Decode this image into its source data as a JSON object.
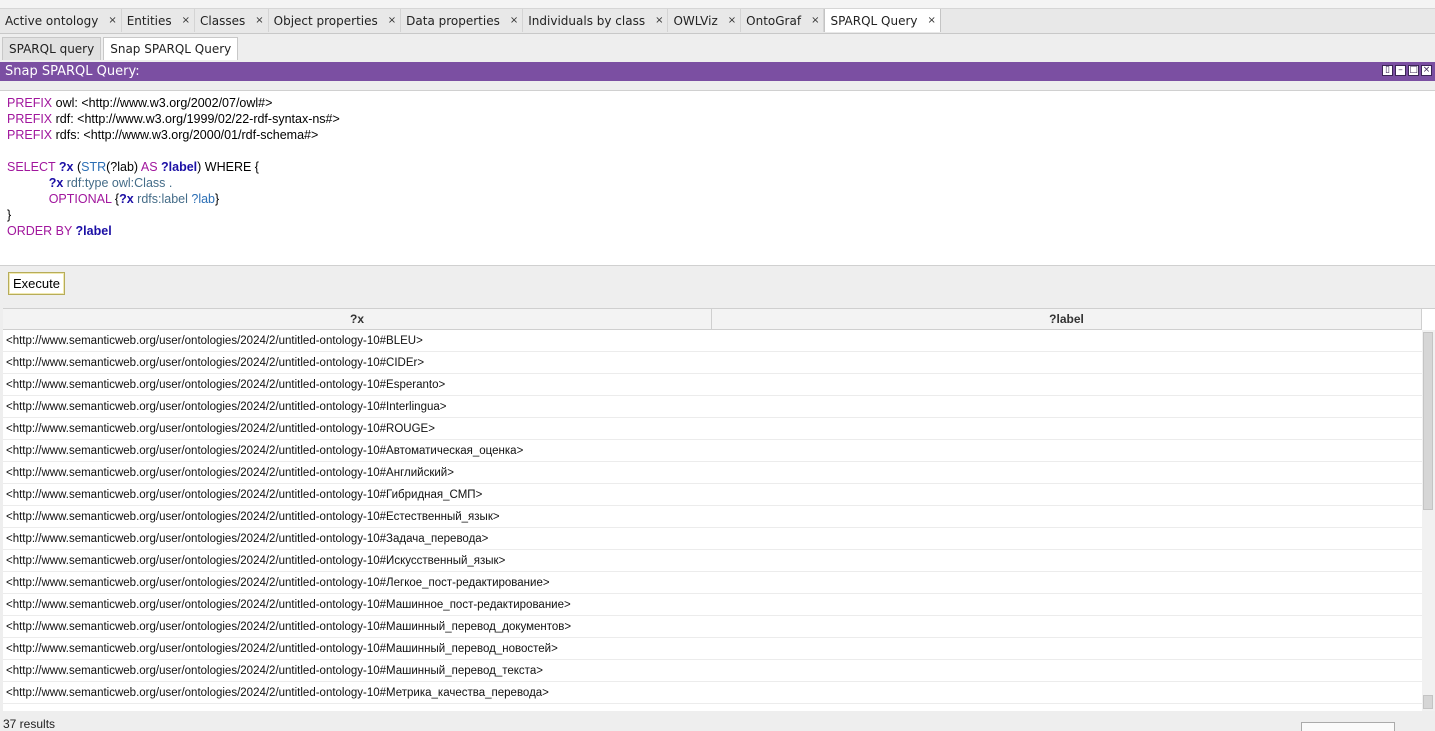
{
  "tabs": [
    {
      "label": "Active ontology",
      "active": false
    },
    {
      "label": "Entities",
      "active": false
    },
    {
      "label": "Classes",
      "active": false
    },
    {
      "label": "Object properties",
      "active": false
    },
    {
      "label": "Data properties",
      "active": false
    },
    {
      "label": "Individuals by class",
      "active": false
    },
    {
      "label": "OWLViz",
      "active": false
    },
    {
      "label": "OntoGraf",
      "active": false
    },
    {
      "label": "SPARQL Query",
      "active": true
    }
  ],
  "tab_close_glyph": "×",
  "subtabs": [
    {
      "label": "SPARQL query",
      "active": false
    },
    {
      "label": "Snap SPARQL Query",
      "active": true
    }
  ],
  "view": {
    "title": "Snap SPARQL Query:",
    "accent_color": "#7b4fa2"
  },
  "query": {
    "prefix_kw": "PREFIX",
    "prefixes": [
      {
        "name": " owl: ",
        "iri": "<http://www.w3.org/2002/07/owl#>"
      },
      {
        "name": " rdf: ",
        "iri": "<http://www.w3.org/1999/02/22-rdf-syntax-ns#>"
      },
      {
        "name": " rdfs: ",
        "iri": "<http://www.w3.org/2000/01/rdf-schema#>"
      }
    ],
    "select_kw": "SELECT",
    "var_x": "?x",
    "open_paren": " (",
    "str_fn": "STR",
    "lab_arg": "(?lab)",
    "as_kw": " AS ",
    "var_label": "?label",
    "close_paren_where": ") WHERE {",
    "indent": "            ",
    "rdf_type": " rdf:type",
    "owl_class": " owl:Class .",
    "optional_kw": "OPTIONAL",
    "optional_open": " {",
    "rdfs_label": " rdfs:label",
    "var_lab": " ?lab",
    "optional_close": "}",
    "close_brace": "}",
    "order_kw": "ORDER BY ",
    "order_var": "?label"
  },
  "execute_button": "Execute",
  "results": {
    "columns": [
      "?x",
      "?label"
    ],
    "rows": [
      "<http://www.semanticweb.org/user/ontologies/2024/2/untitled-ontology-10#BLEU>",
      "<http://www.semanticweb.org/user/ontologies/2024/2/untitled-ontology-10#CIDEr>",
      "<http://www.semanticweb.org/user/ontologies/2024/2/untitled-ontology-10#Esperanto>",
      "<http://www.semanticweb.org/user/ontologies/2024/2/untitled-ontology-10#Interlingua>",
      "<http://www.semanticweb.org/user/ontologies/2024/2/untitled-ontology-10#ROUGE>",
      "<http://www.semanticweb.org/user/ontologies/2024/2/untitled-ontology-10#Автоматическая_оценка>",
      "<http://www.semanticweb.org/user/ontologies/2024/2/untitled-ontology-10#Английский>",
      "<http://www.semanticweb.org/user/ontologies/2024/2/untitled-ontology-10#Гибридная_СМП>",
      "<http://www.semanticweb.org/user/ontologies/2024/2/untitled-ontology-10#Естественный_язык>",
      "<http://www.semanticweb.org/user/ontologies/2024/2/untitled-ontology-10#Задача_перевода>",
      "<http://www.semanticweb.org/user/ontologies/2024/2/untitled-ontology-10#Искусственный_язык>",
      "<http://www.semanticweb.org/user/ontologies/2024/2/untitled-ontology-10#Легкое_пост-редактирование>",
      "<http://www.semanticweb.org/user/ontologies/2024/2/untitled-ontology-10#Машинное_пост-редактирование>",
      "<http://www.semanticweb.org/user/ontologies/2024/2/untitled-ontology-10#Машинный_перевод_документов>",
      "<http://www.semanticweb.org/user/ontologies/2024/2/untitled-ontology-10#Машинный_перевод_новостей>",
      "<http://www.semanticweb.org/user/ontologies/2024/2/untitled-ontology-10#Машинный_перевод_текста>",
      "<http://www.semanticweb.org/user/ontologies/2024/2/untitled-ontology-10#Метрика_качества_перевода>"
    ]
  },
  "status": {
    "results_count": "37 results"
  }
}
